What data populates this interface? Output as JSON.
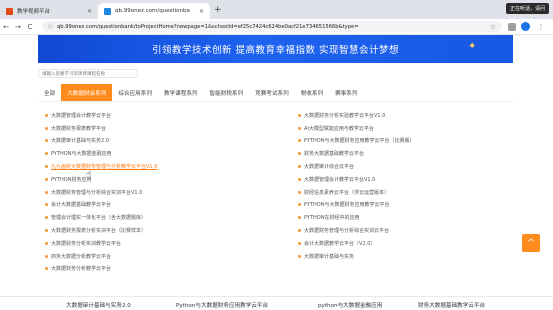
{
  "browser": {
    "tabs": [
      {
        "title": "教学视频平台",
        "active": false
      },
      {
        "title": "qb.99onez.com/questionba",
        "active": true
      }
    ],
    "new_tab": "+",
    "restore_badge": "正在听话，请问",
    "url": "qb.99onez.com/questionbank/toProjectHome?newpage=1&schoolid=ef25c7424c624be0acf21e734651566b&type=",
    "back": "←",
    "forward": "→",
    "reload": "C",
    "lock": "ⓘ",
    "bookmark": "☆"
  },
  "banner": {
    "text": "引领教学技术创新   提高教育幸福指数   实现智慧会计梦想"
  },
  "search": {
    "placeholder": "请输入您要学习的项目课程名称"
  },
  "categories": [
    "全部",
    "大数据财会系列",
    "综合应用系列",
    "教学课程系列",
    "智能财税系列",
    "竞赛考试系列",
    "税收系列",
    "赛事系列"
  ],
  "active_category": "大数据财会系列",
  "list": {
    "left": [
      "大数据管理会计教学云平台",
      "大数据财务报表教学平台",
      "大数据审计基础与实务2.0",
      "PYTHON与大数据金融应用",
      "九九画财大数据财务管理与分析教学云平台V1.0",
      "PYTHON财务应用",
      "大数据财务管理与分析综合实训平台V1.0",
      "会计大数据基础教学云平台",
      "管理会计理实一体化平台（含大数据题库）",
      "大数据财务报表分析实训平台（比赛样本）",
      "大数据财务分析实训教学云平台",
      "商务大数据分析教学云平台",
      "大数据财务分析教学云平台"
    ],
    "right": [
      "大数据财务分析实验教学云平台V1.0",
      "AI大模型赋能应用与教学云平台",
      "PYTHON与大数据财务应用教学云平台（比赛版）",
      "财务大数据基础教学云平台",
      "大数据审计综合云平台",
      "大数据管理会计教学云平台V1.0",
      "财经信息素养云平台（浮云运营版本）",
      "PYTHON与大数据财务应用教学云平台",
      "PYTHON在财经中的应用",
      "大数据财务管理与分析综合实训云平台",
      "会计大数据教学云平台（V2.0）",
      "大数据审计基础与实务"
    ],
    "highlighted_left_index": 4
  },
  "scroll_top_icon": "^",
  "footer": {
    "items": [
      "大数据审计基础与实务2.0",
      "Python与大数据财务应用教学云平台",
      "python与大数据金融应用",
      "财务大数据基础教学云平台"
    ]
  }
}
